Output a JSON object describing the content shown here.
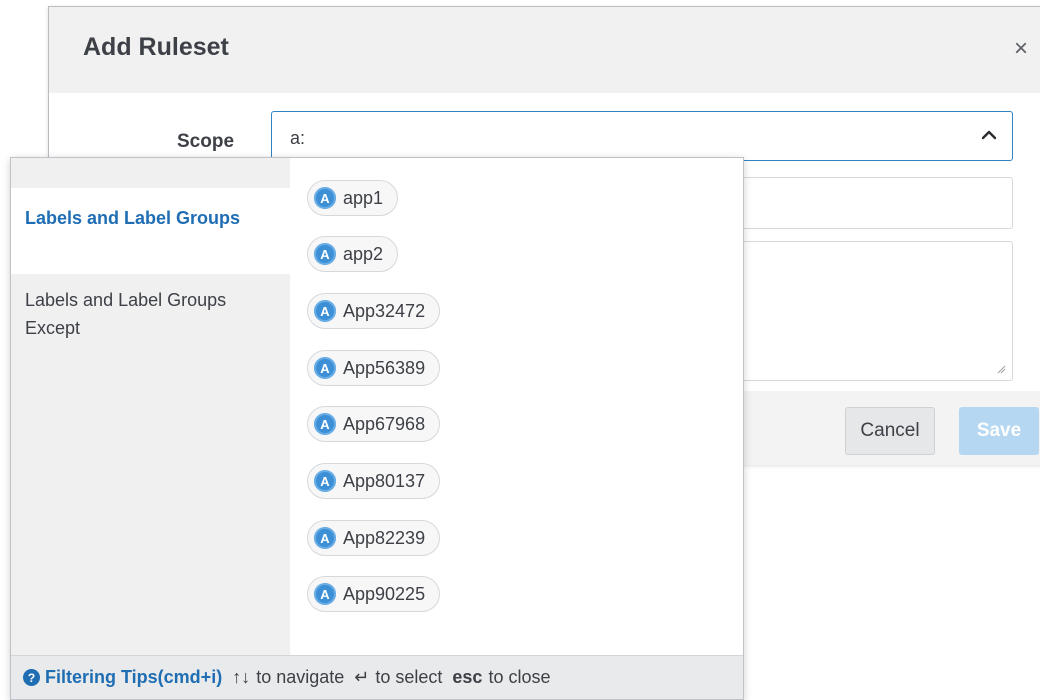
{
  "modal": {
    "title": "Add Ruleset",
    "close_icon": "×",
    "scope_label": "Scope",
    "scope_value": "a:",
    "buttons": {
      "cancel": "Cancel",
      "save": "Save"
    }
  },
  "dropdown": {
    "categories": [
      {
        "label": "Labels and Label Groups",
        "active": true
      },
      {
        "label": "Labels and Label Groups Except",
        "active": false
      }
    ],
    "items": [
      {
        "icon": "A",
        "label": "app1"
      },
      {
        "icon": "A",
        "label": "app2"
      },
      {
        "icon": "A",
        "label": "App32472"
      },
      {
        "icon": "A",
        "label": "App56389"
      },
      {
        "icon": "A",
        "label": "App67968"
      },
      {
        "icon": "A",
        "label": "App80137"
      },
      {
        "icon": "A",
        "label": "App82239"
      },
      {
        "icon": "A",
        "label": "App90225"
      }
    ],
    "footer": {
      "help_icon": "?",
      "filtering_tips": "Filtering Tips(cmd+i)",
      "nav_arrows": "↑↓",
      "nav_text": "to navigate",
      "enter_key": "↵",
      "select_text": "to select",
      "esc_key": "esc",
      "close_text": "to close"
    }
  },
  "colors": {
    "accent": "#1f6eb4",
    "label_icon": "#3d8fd6",
    "save_disabled": "#b6d7f1"
  }
}
